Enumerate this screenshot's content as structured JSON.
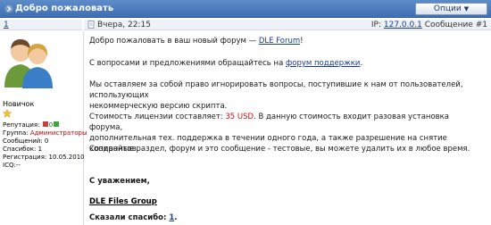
{
  "header": {
    "title": "Добро пожаловать",
    "options_label": "Опции",
    "caret": "▼"
  },
  "post_meta": {
    "number_link": "1",
    "date": "Вчера, 22:15",
    "ip_label": "IP:",
    "ip": "127.0.0.1",
    "message_label": "Сообщение",
    "message_num": "#1"
  },
  "user": {
    "rank": "Новичок",
    "reputation_label": "Репутация:",
    "reputation_value": "0",
    "group_label": "Группа:",
    "group_value": "Администраторы",
    "messages": "Сообщений: 0",
    "thanks": "Спасибок: 1",
    "registration": "Регистрация: 10.05.2010",
    "icq": "ICQ:--"
  },
  "message": {
    "p1_text": "Добро пожаловать в ваш новый форум —",
    "p1_link": "DLE Forum",
    "p1_end": "!",
    "p2_text": "С вопросами и предложениями обращайтесь на",
    "p2_link": "форум поддержки",
    "p2_end": ".",
    "p3_line1": "Мы оставляем за собой право игнорировать вопросы, поступившие к нам от пользователей, использующих",
    "p3_line2": "некоммерческую версию скрипта.",
    "p4_pre": "Стоимость лицензии составляет:",
    "p4_price": "35 USD",
    "p4_post": ". В данную стоимость входит разовая установка форума,",
    "p4_line2": "дополнительная тех. поддержка в течении одного года, а также разрешение на снятие копирайтов.",
    "p5": "Созданные раздел, форум и это сообщение - тестовые, вы можете удалить их в любое время.",
    "regards": "С уважением,",
    "team": "DLE Files Group",
    "said_thanks": "Сказали спасибо:",
    "said_thanks_link": "1",
    "said_thanks_end": "."
  },
  "colors": {
    "header_bg": "#4a7bbf",
    "price": "#d01010",
    "group": "#c00000",
    "link": "#1a3a8c"
  }
}
